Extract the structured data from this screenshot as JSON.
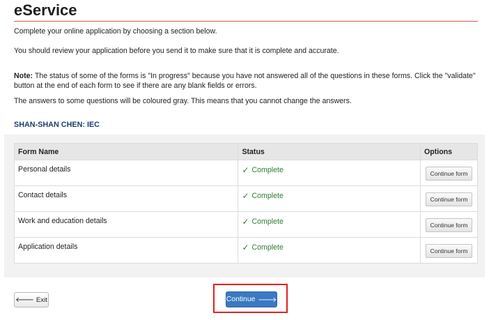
{
  "page": {
    "title": "eService",
    "intro": "Complete your online application by choosing a section below.",
    "review": "You should review your application before you send it to make sure that it is complete and accurate.",
    "note_label": "Note:",
    "note_text": " The status of some of the forms is \"In progress\" because you have not answered all of the questions in these forms. Click the \"validate\" button at the end of each form to see if there are any blank fields or errors.",
    "gray_note": "The answers to some questions will be coloured gray. This means that you cannot change the answers.",
    "applicant": "SHAN-SHAN CHEN: IEC"
  },
  "table": {
    "headers": {
      "name": "Form Name",
      "status": "Status",
      "options": "Options"
    },
    "rows": [
      {
        "name": "Personal details",
        "status": "Complete",
        "action": "Continue form"
      },
      {
        "name": "Contact details",
        "status": "Complete",
        "action": "Continue form"
      },
      {
        "name": "Work and education details",
        "status": "Complete",
        "action": "Continue form"
      },
      {
        "name": "Application details",
        "status": "Complete",
        "action": "Continue form"
      }
    ]
  },
  "footer": {
    "exit_label": "Exit",
    "continue_label": "Continue"
  },
  "colors": {
    "accent_rule": "#d9534f",
    "applicant": "#1d3d6e",
    "complete": "#2e7d32",
    "continue_button": "#3a79c2",
    "highlight": "#e0211d"
  },
  "icons": {
    "status": "checkmark-icon",
    "exit": "arrow-left-icon",
    "continue": "arrow-right-icon"
  }
}
